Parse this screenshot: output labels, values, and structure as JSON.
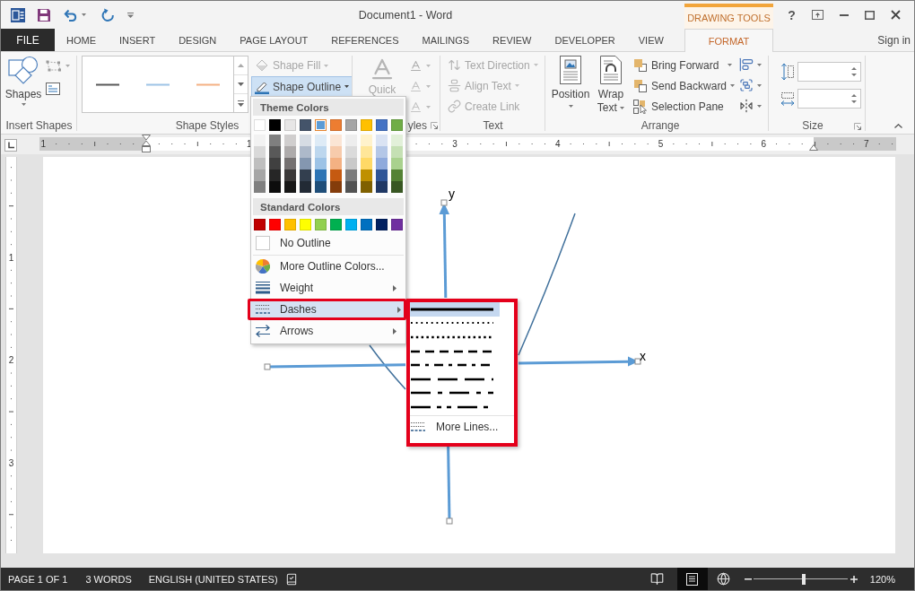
{
  "window": {
    "title": "Document1 - Word",
    "tool_group": "DRAWING TOOLS",
    "help": "?",
    "sign_in": "Sign in"
  },
  "tabs": [
    {
      "label": "FILE",
      "kind": "file",
      "selected": false
    },
    {
      "label": "HOME",
      "kind": "main",
      "selected": false
    },
    {
      "label": "INSERT",
      "kind": "main",
      "selected": false
    },
    {
      "label": "DESIGN",
      "kind": "main",
      "selected": false
    },
    {
      "label": "PAGE LAYOUT",
      "kind": "main",
      "selected": false
    },
    {
      "label": "REFERENCES",
      "kind": "main",
      "selected": false
    },
    {
      "label": "MAILINGS",
      "kind": "main",
      "selected": false
    },
    {
      "label": "REVIEW",
      "kind": "main",
      "selected": false
    },
    {
      "label": "DEVELOPER",
      "kind": "main",
      "selected": false
    },
    {
      "label": "VIEW",
      "kind": "main",
      "selected": false
    },
    {
      "label": "FORMAT",
      "kind": "context",
      "selected": true
    }
  ],
  "ribbon": {
    "insert_shapes": {
      "shapes": "Shapes",
      "label": "Insert Shapes"
    },
    "shape_styles": {
      "label": "Shape Styles",
      "fill": {
        "label": "Shape Fill",
        "disabled": true
      },
      "outline": {
        "label": "Shape Outline",
        "selected": true
      }
    },
    "wordart_styles": {
      "quick": "Quick",
      "label": "yles"
    },
    "text": {
      "label": "Text",
      "items": [
        {
          "label": "Text Direction",
          "kind": "direction",
          "disabled": true
        },
        {
          "label": "Align Text",
          "kind": "align",
          "disabled": true
        },
        {
          "label": "Create Link",
          "kind": "link",
          "disabled": true
        }
      ]
    },
    "arrange": {
      "label": "Arrange",
      "position": "Position",
      "wrap_text": "Wrap Text",
      "items": [
        {
          "label": "Bring Forward",
          "kind": "forward"
        },
        {
          "label": "Send Backward",
          "kind": "backward"
        },
        {
          "label": "Selection Pane",
          "kind": "pane"
        }
      ]
    },
    "size": {
      "label": "Size"
    }
  },
  "ruler": {
    "horizontal": [
      "1",
      "1",
      "3",
      "4",
      "5",
      "6",
      "7"
    ],
    "vertical": [
      "1",
      "2",
      "3"
    ]
  },
  "canvas": {
    "y_label": "y",
    "x_label": "x"
  },
  "outline_menu": {
    "theme_title": "Theme Colors",
    "theme_columns": [
      {
        "color": "#ffffff",
        "selected": false,
        "shades": [
          {
            "color": "#f2f2f2",
            "selected": false
          },
          {
            "color": "#d9d9d9",
            "selected": false
          },
          {
            "color": "#bfbfbf",
            "selected": false
          },
          {
            "color": "#a6a6a6",
            "selected": false
          },
          {
            "color": "#808080",
            "selected": false
          }
        ]
      },
      {
        "color": "#000000",
        "selected": false,
        "shades": [
          {
            "color": "#7f7f7f",
            "selected": false
          },
          {
            "color": "#595959",
            "selected": false
          },
          {
            "color": "#404040",
            "selected": false
          },
          {
            "color": "#262626",
            "selected": false
          },
          {
            "color": "#0d0d0d",
            "selected": false
          }
        ]
      },
      {
        "color": "#e7e6e6",
        "selected": false,
        "shades": [
          {
            "color": "#d0cece",
            "selected": false
          },
          {
            "color": "#aeabab",
            "selected": false
          },
          {
            "color": "#757171",
            "selected": false
          },
          {
            "color": "#3a3838",
            "selected": false
          },
          {
            "color": "#171717",
            "selected": false
          }
        ]
      },
      {
        "color": "#44546a",
        "selected": false,
        "shades": [
          {
            "color": "#d6dce4",
            "selected": false
          },
          {
            "color": "#adb9ca",
            "selected": false
          },
          {
            "color": "#8497b0",
            "selected": false
          },
          {
            "color": "#333f4f",
            "selected": false
          },
          {
            "color": "#222a35",
            "selected": false
          }
        ]
      },
      {
        "color": "#5b9bd5",
        "selected": true,
        "shades": [
          {
            "color": "#deebf6",
            "selected": false
          },
          {
            "color": "#bdd7ee",
            "selected": false
          },
          {
            "color": "#9dc3e6",
            "selected": false
          },
          {
            "color": "#2e75b5",
            "selected": false
          },
          {
            "color": "#1f4e79",
            "selected": false
          }
        ]
      },
      {
        "color": "#ed7d31",
        "selected": false,
        "shades": [
          {
            "color": "#fbe5d5",
            "selected": false
          },
          {
            "color": "#f7cbac",
            "selected": false
          },
          {
            "color": "#f4b183",
            "selected": false
          },
          {
            "color": "#c55a11",
            "selected": false
          },
          {
            "color": "#843c0b",
            "selected": false
          }
        ]
      },
      {
        "color": "#a5a5a5",
        "selected": false,
        "shades": [
          {
            "color": "#ededed",
            "selected": false
          },
          {
            "color": "#dbdbdb",
            "selected": false
          },
          {
            "color": "#c9c9c9",
            "selected": false
          },
          {
            "color": "#7b7b7b",
            "selected": false
          },
          {
            "color": "#525252",
            "selected": false
          }
        ]
      },
      {
        "color": "#ffc000",
        "selected": false,
        "shades": [
          {
            "color": "#fff2cc",
            "selected": false
          },
          {
            "color": "#ffe699",
            "selected": false
          },
          {
            "color": "#ffd966",
            "selected": false
          },
          {
            "color": "#bf9000",
            "selected": false
          },
          {
            "color": "#7f6000",
            "selected": false
          }
        ]
      },
      {
        "color": "#4472c4",
        "selected": false,
        "shades": [
          {
            "color": "#dae3f3",
            "selected": false
          },
          {
            "color": "#b4c7e7",
            "selected": false
          },
          {
            "color": "#8faadc",
            "selected": false
          },
          {
            "color": "#2f5597",
            "selected": false
          },
          {
            "color": "#203864",
            "selected": false
          }
        ]
      },
      {
        "color": "#70ad47",
        "selected": false,
        "shades": [
          {
            "color": "#e2f0d9",
            "selected": false
          },
          {
            "color": "#c5e0b4",
            "selected": false
          },
          {
            "color": "#a9d18e",
            "selected": false
          },
          {
            "color": "#548235",
            "selected": false
          },
          {
            "color": "#385723",
            "selected": false
          }
        ]
      }
    ],
    "standard_title": "Standard Colors",
    "standard_colors": [
      {
        "color": "#c00000",
        "selected": false
      },
      {
        "color": "#ff0000",
        "selected": false
      },
      {
        "color": "#ffc000",
        "selected": false
      },
      {
        "color": "#ffff00",
        "selected": false
      },
      {
        "color": "#92d050",
        "selected": false
      },
      {
        "color": "#00b050",
        "selected": false
      },
      {
        "color": "#00b0f0",
        "selected": false
      },
      {
        "color": "#0070c0",
        "selected": false
      },
      {
        "color": "#002060",
        "selected": false
      },
      {
        "color": "#7030a0",
        "selected": false
      }
    ],
    "items": [
      {
        "label": "No Outline",
        "kind": "none",
        "submenu": false,
        "divider_above": false,
        "selected": false,
        "highlighted": false
      },
      {
        "label": "More Outline Colors...",
        "kind": "more",
        "submenu": false,
        "divider_above": true,
        "selected": false,
        "highlighted": false
      },
      {
        "label": "Weight",
        "kind": "weight",
        "submenu": true,
        "divider_above": false,
        "selected": false,
        "highlighted": false
      },
      {
        "label": "Dashes",
        "kind": "dashes",
        "submenu": true,
        "divider_above": false,
        "selected": true,
        "highlighted": true
      },
      {
        "label": "Arrows",
        "kind": "arrows",
        "submenu": true,
        "divider_above": false,
        "selected": false,
        "highlighted": false
      }
    ]
  },
  "dashes_menu": {
    "highlighted": true,
    "styles": [
      {
        "kind": "solid",
        "selected": true
      },
      {
        "kind": "rounddot",
        "selected": false
      },
      {
        "kind": "squaredot",
        "selected": false
      },
      {
        "kind": "dash",
        "selected": false
      },
      {
        "kind": "dashdot",
        "selected": false
      },
      {
        "kind": "longdash",
        "selected": false
      },
      {
        "kind": "longdashdot",
        "selected": false
      },
      {
        "kind": "longdashdotdot",
        "selected": false
      }
    ],
    "more": "More Lines..."
  },
  "status_bar": {
    "page": "PAGE 1 OF 1",
    "words": "3 WORDS",
    "language": "ENGLISH (UNITED STATES)",
    "views": [
      {
        "kind": "read",
        "selected": false
      },
      {
        "kind": "print",
        "selected": true
      },
      {
        "kind": "web",
        "selected": false
      }
    ],
    "zoom": {
      "level": 0.53,
      "reading": "120%"
    }
  }
}
